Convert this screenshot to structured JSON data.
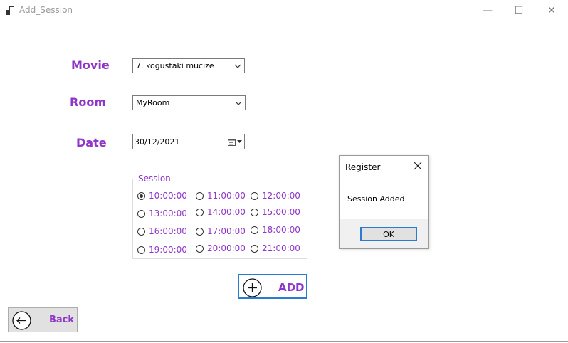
{
  "window": {
    "title": "Add_Session",
    "controls": {
      "minimize": "—",
      "maximize": "☐",
      "close": "✕"
    }
  },
  "form": {
    "movie_label": "Movie",
    "movie_value": "7. kogustaki mucize",
    "room_label": "Room",
    "room_value": "MyRoom",
    "date_label": "Date",
    "date_value": "30/12/2021"
  },
  "session": {
    "title": "Session",
    "selected": "10:00:00",
    "options": [
      "10:00:00",
      "11:00:00",
      "12:00:00",
      "13:00:00",
      "14:00:00",
      "15:00:00",
      "16:00:00",
      "17:00:00",
      "18:00:00",
      "19:00:00",
      "20:00:00",
      "21:00:00"
    ]
  },
  "buttons": {
    "add_label": "ADD",
    "back_label": "Back"
  },
  "dialog": {
    "title": "Register",
    "message": "Session Added",
    "ok_label": "OK"
  },
  "colors": {
    "accent": "#8f36c8",
    "focus_border": "#2b7bd3"
  },
  "icons": {
    "app": "app-icon",
    "plus": "plus-circle-icon",
    "back": "arrow-left-circle-icon",
    "calendar": "calendar-icon",
    "dropdown": "chevron-down-icon"
  }
}
